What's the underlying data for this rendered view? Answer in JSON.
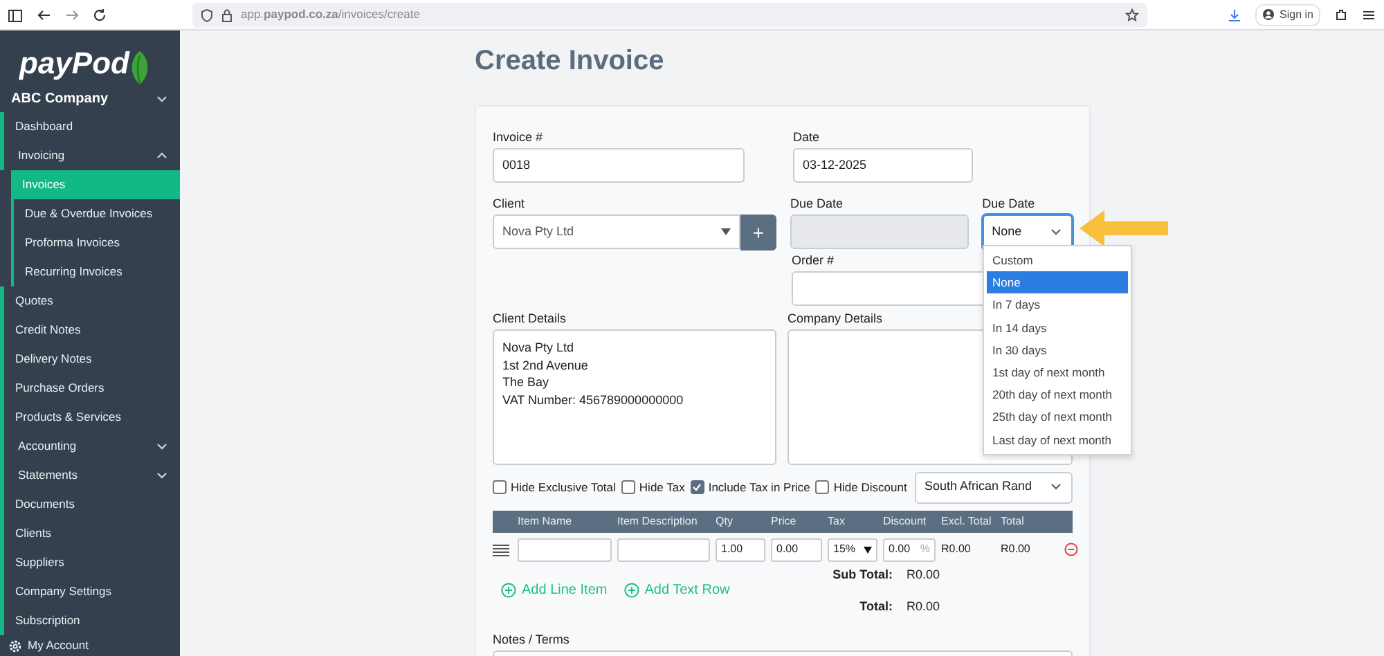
{
  "browser": {
    "url": "app.**paypod.co.za**/invoices/create",
    "sign_in": "Sign in"
  },
  "sidebar": {
    "logo": "payPod",
    "company": "ABC Company",
    "items": [
      {
        "label": "Dashboard",
        "kind": "link"
      },
      {
        "label": "Invoicing",
        "kind": "group",
        "expanded": true,
        "children": [
          {
            "label": "Invoices",
            "selected": true
          },
          {
            "label": "Due & Overdue Invoices",
            "selected": false
          },
          {
            "label": "Proforma Invoices",
            "selected": false
          },
          {
            "label": "Recurring Invoices",
            "selected": false
          }
        ]
      },
      {
        "label": "Quotes",
        "kind": "link"
      },
      {
        "label": "Credit Notes",
        "kind": "link"
      },
      {
        "label": "Delivery Notes",
        "kind": "link"
      },
      {
        "label": "Purchase Orders",
        "kind": "link"
      },
      {
        "label": "Products & Services",
        "kind": "link"
      },
      {
        "label": "Accounting",
        "kind": "group",
        "expanded": false
      },
      {
        "label": "Statements",
        "kind": "group",
        "expanded": false
      },
      {
        "label": "Documents",
        "kind": "link"
      },
      {
        "label": "Clients",
        "kind": "link"
      },
      {
        "label": "Suppliers",
        "kind": "link"
      },
      {
        "label": "Company Settings",
        "kind": "link"
      },
      {
        "label": "Subscription",
        "kind": "link"
      },
      {
        "label": "My Account",
        "kind": "account"
      }
    ]
  },
  "page": {
    "title": "Create Invoice"
  },
  "form": {
    "invoice_no": {
      "label": "Invoice #",
      "value": "0018"
    },
    "date": {
      "label": "Date",
      "value": "03-12-2025"
    },
    "client": {
      "label": "Client",
      "value": "Nova Pty Ltd",
      "add_button": "+"
    },
    "due_date": {
      "label": "Due Date",
      "disabled": true
    },
    "due_term": {
      "label": "Due Date",
      "value": "None",
      "expanded": true,
      "options": [
        {
          "label": "Custom",
          "selected": false
        },
        {
          "label": "None",
          "selected": true
        },
        {
          "label": "In 7 days",
          "selected": false
        },
        {
          "label": "In 14 days",
          "selected": false
        },
        {
          "label": "In 30 days",
          "selected": false
        },
        {
          "label": "1st day of next month",
          "selected": false
        },
        {
          "label": "20th day of next month",
          "selected": false
        },
        {
          "label": "25th day of next month",
          "selected": false
        },
        {
          "label": "Last day of next month",
          "selected": false
        }
      ]
    },
    "order_no": {
      "label": "Order #"
    },
    "client_details": {
      "label": "Client Details",
      "lines": [
        "Nova Pty Ltd",
        "1st 2nd Avenue",
        "The Bay",
        "VAT Number: 456789000000000"
      ]
    },
    "company_details": {
      "label": "Company Details"
    },
    "options": [
      {
        "label": "Hide Exclusive Total",
        "checked": false
      },
      {
        "label": "Hide Tax",
        "checked": false
      },
      {
        "label": "Include Tax in Price",
        "checked": true
      },
      {
        "label": "Hide Discount",
        "checked": false
      }
    ],
    "currency": "South African Rand"
  },
  "table": {
    "columns": [
      "Item Name",
      "Item Description",
      "Qty",
      "Price",
      "Tax",
      "Discount",
      "Excl. Total",
      "Total"
    ],
    "rows": [
      {
        "qty": "1.00",
        "price": "0.00",
        "tax": "15%",
        "discount": "0.00",
        "discount_unit": "%",
        "excl_total": "R0.00",
        "total": "R0.00"
      }
    ]
  },
  "actions": [
    "Add Line Item",
    "Add Text Row"
  ],
  "totals": [
    {
      "label": "Sub Total:",
      "value": "R0.00"
    },
    {
      "label": "Total:",
      "value": "R0.00"
    }
  ],
  "notes": {
    "label": "Notes / Terms"
  }
}
